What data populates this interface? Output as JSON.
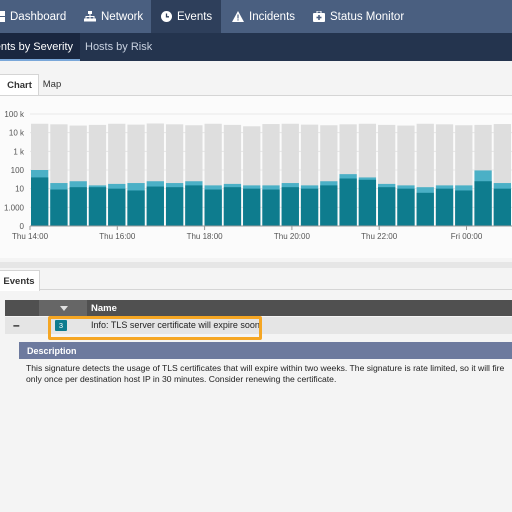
{
  "topnav": {
    "items": [
      {
        "label": "Dashboard",
        "icon": "dashboard-icon"
      },
      {
        "label": "Network",
        "icon": "network-icon"
      },
      {
        "label": "Events",
        "icon": "clock-icon",
        "active": true
      },
      {
        "label": "Incidents",
        "icon": "warning-icon"
      },
      {
        "label": "Status Monitor",
        "icon": "monitor-icon"
      }
    ]
  },
  "subnav": {
    "tabs": [
      {
        "label": "Events by Severity",
        "active": true
      },
      {
        "label": "Hosts by Risk"
      }
    ]
  },
  "chart_tabs": [
    {
      "label": "Chart",
      "active": true
    },
    {
      "label": "Map"
    }
  ],
  "chart_data": {
    "type": "bar",
    "y_scale": "log",
    "yticks": [
      "100 k",
      "10 k",
      "1 k",
      "100",
      "10",
      "1.000",
      "0"
    ],
    "xticks": [
      "Thu 14:00",
      "Thu 16:00",
      "Thu 18:00",
      "Thu 20:00",
      "Thu 22:00",
      "Fri 00:00"
    ],
    "series": [
      {
        "color": "#0e7c8e",
        "values": [
          40,
          9,
          12,
          12,
          10,
          8,
          13,
          12,
          15,
          9,
          12,
          10,
          9,
          12,
          10,
          15,
          35,
          30,
          12,
          10,
          6,
          10,
          8,
          25,
          10
        ]
      },
      {
        "color": "#4bb0c6",
        "values": [
          100,
          20,
          25,
          15,
          18,
          20,
          25,
          20,
          25,
          15,
          18,
          15,
          15,
          20,
          15,
          25,
          60,
          40,
          18,
          15,
          12,
          15,
          15,
          95,
          20
        ]
      },
      {
        "color": "#dedede",
        "values": [
          30000,
          28000,
          24000,
          26000,
          30000,
          27000,
          31000,
          28000,
          25000,
          30000,
          26000,
          22000,
          29000,
          30000,
          27000,
          25000,
          28000,
          30000,
          26000,
          24000,
          30000,
          28000,
          25000,
          26000,
          29000
        ]
      }
    ]
  },
  "events_tab": {
    "label": "Events"
  },
  "table": {
    "col_name": "Name",
    "row": {
      "expand": "–",
      "severity": "3",
      "name": "Info: TLS server certificate will expire soon"
    }
  },
  "description": {
    "title": "Description",
    "text": "This signature detects the usage of TLS certificates that will expire within two weeks. The signature is rate limited, so it will fire only once per destination host IP in 30 minutes. Consider renewing the certificate."
  },
  "colors": {
    "nav": "#4a5f80",
    "subnav": "#24344e",
    "teal": "#0e7c8e",
    "highlight": "#f5a623"
  }
}
